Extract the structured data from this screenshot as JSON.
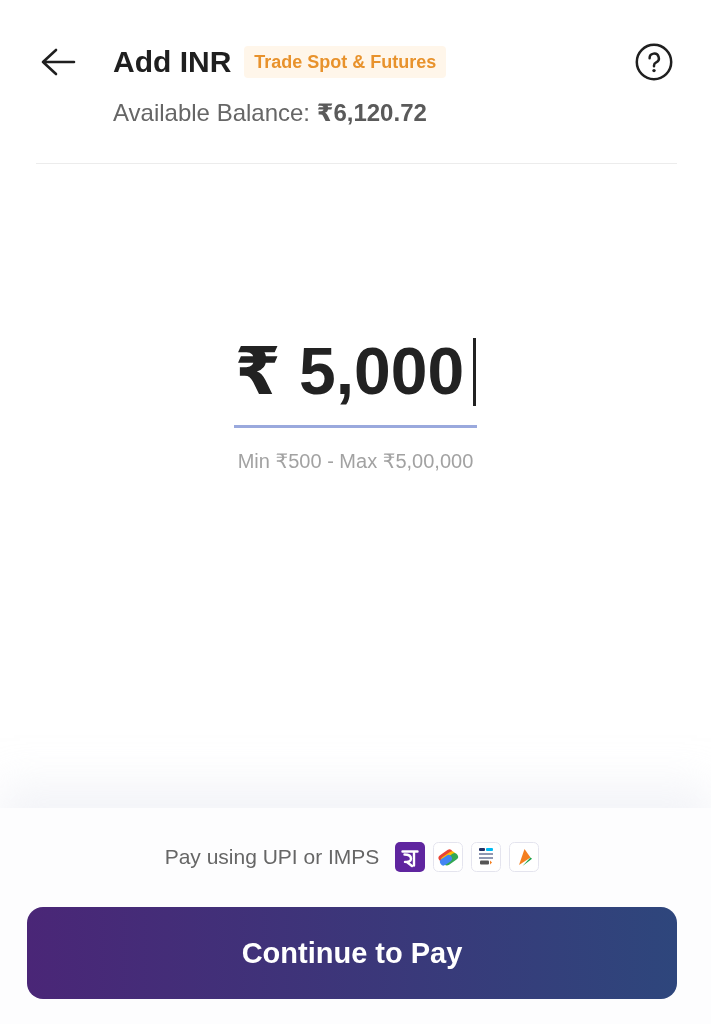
{
  "header": {
    "title": "Add INR",
    "badge": "Trade Spot & Futures",
    "balance": "Available Balance: **₹6,120.72**"
  },
  "amount_field": {
    "value": "₹ 5,000",
    "focused": true
  },
  "limits": "Min ₹500 - Max ₹5,00,000",
  "footer": {
    "payment_note": "Pay using UPI or IMPS",
    "button": "Continue to Pay"
  }
}
